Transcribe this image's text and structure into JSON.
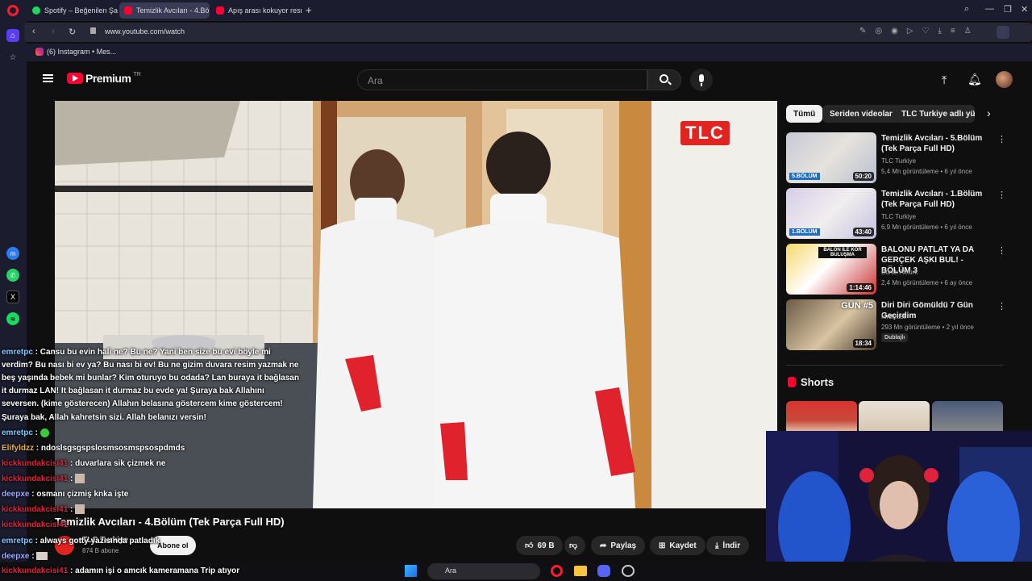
{
  "browser": {
    "tabs": [
      {
        "label": "Spotify – Beğenilen Şarkıl",
        "icon": "spotify-icon",
        "active": false
      },
      {
        "label": "Temizlik Avcıları - 4.Bö",
        "icon": "youtube-icon",
        "active": true
      },
      {
        "label": "Apış arası kokuyor resmen",
        "icon": "youtube-icon",
        "active": false
      }
    ],
    "new_tab": "+",
    "url": "www.youtube.com/watch",
    "bookmark": "(6) Instagram • Mes..."
  },
  "youtube": {
    "logo_text": "Premium",
    "logo_badge": "TR",
    "search_placeholder": "Ara",
    "chips": [
      "Tümü",
      "Seriden videolar",
      "TLC Turkiye adlı yükle"
    ],
    "recommendations": [
      {
        "title": "Temizlik Avcıları - 5.Bölüm (Tek Parça Full HD)",
        "channel": "TLC Turkiye",
        "meta": "5,4 Mn görüntüleme • 6 yıl önce",
        "duration": "50:20",
        "thumb_label": "5.BÖLÜM"
      },
      {
        "title": "Temizlik Avcıları - 1.Bölüm (Tek Parça Full HD)",
        "channel": "TLC Turkiye",
        "meta": "6,9 Mn görüntüleme • 6 yıl önce",
        "duration": "43:40",
        "thumb_label": "1.BÖLÜM"
      },
      {
        "title": "BALONU PATLAT YA DA GERÇEK AŞKI BUL! - BÖLÜM 3",
        "channel": "Burak Aktürk",
        "meta": "2,4 Mn görüntüleme • 6 ay önce",
        "duration": "1:14:46",
        "thumb_label": "BALON İLE KÖR BULUŞMA"
      },
      {
        "title": "Diri Diri Gömüldü 7 Gün Geçirdim",
        "channel": "MrBeast",
        "meta": "293 Mn görüntüleme • 2 yıl önce",
        "duration": "18:34",
        "thumb_label": "GÜN #5",
        "badge": "Dublajlı"
      }
    ],
    "shorts_label": "Shorts",
    "video": {
      "title": "Temizlik Avcıları - 4.Bölüm (Tek Parça Full HD)",
      "channel": "TLC Turkiye",
      "subscribers": "874 B abone",
      "subscribe_label": "Abone ol",
      "likes": "69 B",
      "share": "Paylaş",
      "save": "Kaydet",
      "download": "İndir",
      "watermark": "TLC"
    }
  },
  "chat": [
    {
      "name": "emretpc",
      "color": "#7ec8ff",
      "text": " : Cansu bu evin hali ne? Bu ne? Yani ben size bu evi böyle mi"
    },
    {
      "name": "",
      "color": "#ffffff",
      "text": "verdim? Bu nası bi ev ya? Bu nası bi ev! Bu ne gizim duvara resim yazmak ne"
    },
    {
      "name": "",
      "color": "#ffffff",
      "text": "beş yaşında bebek mi bunlar? Kim oturuyo bu odada? Lan buraya it bağlasan"
    },
    {
      "name": "",
      "color": "#ffffff",
      "text": "it durmaz LAN! It bağlasan it durmaz bu evde ya! Şuraya bak Allahını"
    },
    {
      "name": "",
      "color": "#ffffff",
      "text": "seversen. (kime gösterecen) Allahın belasına göstercem kime göstercem!"
    },
    {
      "name": "",
      "color": "#ffffff",
      "text": "Şuraya bak, Allah kahretsin sizi. Allah belanızı versin!"
    },
    {
      "name": "emretpc",
      "color": "#7ec8ff",
      "text": " : "
    },
    {
      "name": "Elifyldzz",
      "color": "#e8b24a",
      "text": " : ndoslsgsgspslosmsosmspsospdmds"
    },
    {
      "name": "kickkundakcisi41",
      "color": "#e0223a",
      "text": " : duvarlara sik çizmek ne"
    },
    {
      "name": "kickkundakcisi41",
      "color": "#e0223a",
      "text": " : "
    },
    {
      "name": "deepxe",
      "color": "#9fa8ff",
      "text": " : osmanı çizmiş knka işte"
    },
    {
      "name": "kickkundakcisi41",
      "color": "#e0223a",
      "text": " : "
    },
    {
      "name": "kickkundakcisi41",
      "color": "#e0223a",
      "text": ""
    },
    {
      "name": "emretpc",
      "color": "#7ec8ff",
      "text": " : always gotty yazısında patladık"
    },
    {
      "name": "deepxe",
      "color": "#9fa8ff",
      "text": " : "
    },
    {
      "name": "kickkundakcisi41",
      "color": "#e0223a",
      "text": " : adamın işi o amcık kameramana Trip atıyor"
    }
  ],
  "taskbar": {
    "search_placeholder": "Ara"
  }
}
